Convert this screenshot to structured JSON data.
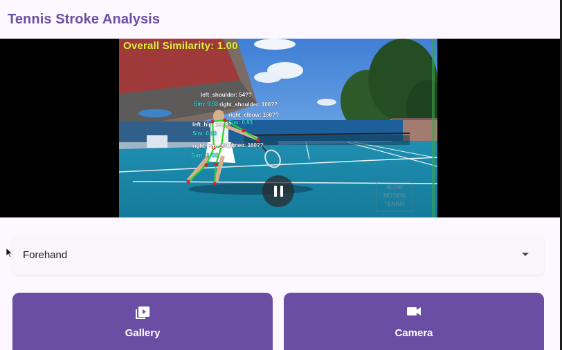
{
  "app": {
    "title": "Tennis Stroke Analysis"
  },
  "video": {
    "overlay_title": "Overall Similarity:  1.00",
    "labels": {
      "left_shoulder": "left_shoulder: 54??",
      "right_shoulder": "right_shoulder: 106??",
      "right_elbow": "right_elbow: 160??",
      "left_hip": "left_hip: 137??",
      "right_hip": "right_hip: 150??",
      "left_knee": "left_knee: 160??",
      "sim_a": "Sim: 0.93",
      "sim_b": "Sim: 0.93",
      "sim_c": "Sim: 0.93",
      "sim_d": "Sim: 1.00"
    },
    "watermark": [
      "SLOW",
      "MOTION",
      "TENNIS"
    ],
    "state": "playing"
  },
  "stroke_select": {
    "selected": "Forehand"
  },
  "buttons": {
    "gallery": "Gallery",
    "camera": "Camera"
  },
  "colors": {
    "primary": "#6a4ea3",
    "background": "#fdf7ff",
    "overlay_text": "#e6f23a"
  }
}
